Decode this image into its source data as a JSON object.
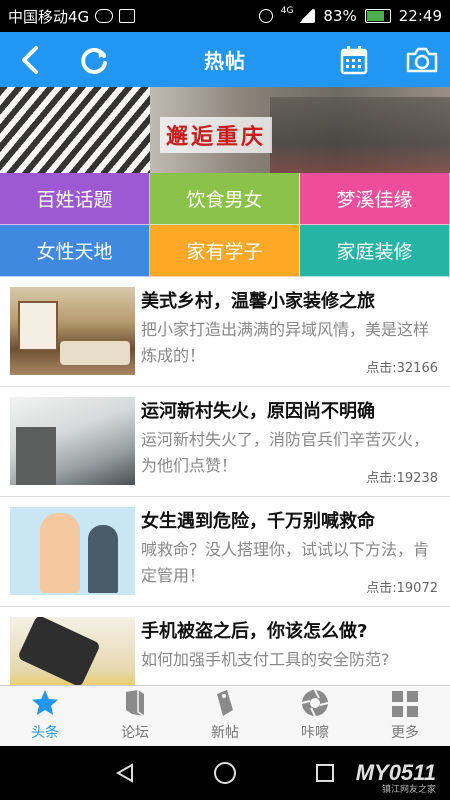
{
  "status_bar": {
    "carrier": "中国移动4G",
    "network": "4G",
    "battery": "83%",
    "time": "22:49"
  },
  "header": {
    "title": "热帖",
    "back_icon": "back-arrow-icon",
    "refresh_icon": "refresh-icon",
    "calendar_icon": "calendar-icon",
    "camera_icon": "camera-icon",
    "color": "#2196f3"
  },
  "banner": {
    "text": "邂逅重庆"
  },
  "categories": [
    {
      "label": "百姓话题",
      "color": "#9c59d1"
    },
    {
      "label": "饮食男女",
      "color": "#8bc34a"
    },
    {
      "label": "梦溪佳缘",
      "color": "#ee4d9b"
    },
    {
      "label": "女性天地",
      "color": "#3f8ae0"
    },
    {
      "label": "家有学子",
      "color": "#ffa726"
    },
    {
      "label": "家庭装修",
      "color": "#26b5a5"
    }
  ],
  "articles": [
    {
      "title": "美式乡村，温馨小家装修之旅",
      "desc": "把小家打造出满满的异域风情，美是这样炼成的！",
      "clicks": "点击:32166"
    },
    {
      "title": "运河新村失火，原因尚不明确",
      "desc": "运河新村失火了，消防官兵们辛苦灭火，为他们点赞！",
      "clicks": "点击:19238"
    },
    {
      "title": "女生遇到危险，千万别喊救命",
      "desc": "喊救命？没人搭理你，试试以下方法，肯定管用！",
      "clicks": "点击:19072"
    },
    {
      "title": "手机被盗之后，你该怎么做?",
      "desc": "如何加强手机支付工具的安全防范?",
      "clicks": ""
    }
  ],
  "tabs": [
    {
      "label": "头条",
      "icon": "star-icon",
      "active": true
    },
    {
      "label": "论坛",
      "icon": "forum-icon",
      "active": false
    },
    {
      "label": "新帖",
      "icon": "new-post-icon",
      "active": false
    },
    {
      "label": "咔嚓",
      "icon": "shutter-icon",
      "active": false
    },
    {
      "label": "更多",
      "icon": "grid-icon",
      "active": false
    }
  ],
  "watermark": {
    "brand": "MY0511",
    "sub": "镇江网友之家"
  }
}
